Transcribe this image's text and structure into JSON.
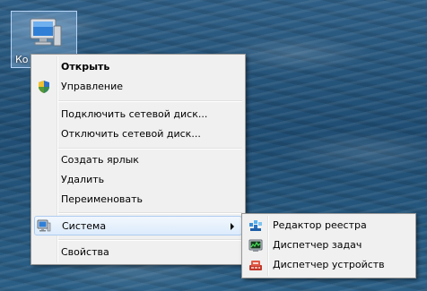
{
  "desktop": {
    "icon_label": "Ко"
  },
  "context_menu": {
    "open": "Открыть",
    "manage": "Управление",
    "map_drive": "Подключить сетевой диск...",
    "disconnect_drive": "Отключить сетевой диск...",
    "create_shortcut": "Создать ярлык",
    "delete": "Удалить",
    "rename": "Переименовать",
    "system": "Система",
    "properties": "Свойства"
  },
  "submenu": {
    "registry_editor": "Редактор реестра",
    "task_manager": "Диспетчер задач",
    "device_manager": "Диспетчер устройств"
  },
  "icons": {
    "desktop_icon": "computer-icon",
    "manage": "shield-icon",
    "system": "monitor-icon",
    "registry_editor": "registry-editor-icon",
    "task_manager": "task-manager-icon",
    "device_manager": "device-manager-icon"
  },
  "colors": {
    "menu_background": "#f0f0f0",
    "highlight_border": "#aeccf0",
    "highlight_fill": "#dcebfc"
  }
}
